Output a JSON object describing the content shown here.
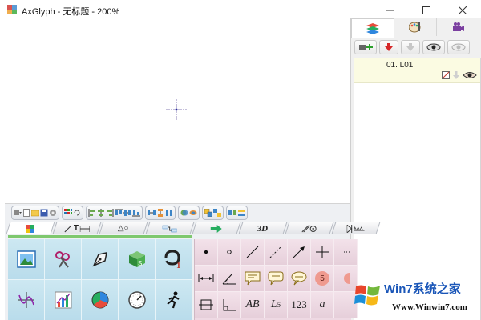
{
  "window": {
    "title": "AxGlyph - 无标题 - 200%"
  },
  "side_panel": {
    "tabs": [
      {
        "icon": "layers-icon",
        "active": true
      },
      {
        "icon": "palette-icon",
        "active": false
      },
      {
        "icon": "camera-icon",
        "active": false
      }
    ],
    "layers": [
      {
        "name": "01. L01"
      }
    ]
  },
  "tool_panel": {
    "category_tabs": [
      {
        "icon": "color-square-icon",
        "label": ""
      },
      {
        "icon": "line-text-icon",
        "label": "T"
      },
      {
        "icon": "shapes-icon",
        "label": "△○"
      },
      {
        "icon": "connector-icon",
        "label": ""
      },
      {
        "icon": "arrow-icon",
        "label": ""
      },
      {
        "icon": "three-d-icon",
        "label": "3D"
      },
      {
        "icon": "pattern-icon",
        "label": ""
      },
      {
        "icon": "circuit-icon",
        "label": ""
      }
    ],
    "small_tools": {
      "text_ab": "AB",
      "text_l": "L",
      "text_l_sub": "5",
      "text_123": "123",
      "text_a": "a",
      "badge_num": "5"
    }
  },
  "watermark": {
    "brand": "Win7系统之家",
    "url": "Www.Winwin7.com"
  },
  "colors": {
    "accent_green": "#7ec86e",
    "big_grid_bg": "#c6e3ee",
    "small_grid_bg": "#eed9e3",
    "layer_row_bg": "#fbfbe2",
    "badge_bg": "#ef9a8f"
  }
}
